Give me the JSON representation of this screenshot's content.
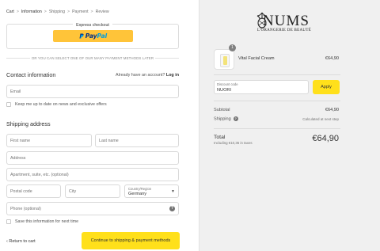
{
  "breadcrumb": {
    "items": [
      "Cart",
      "Information",
      "Shipping",
      "Payment",
      "Review"
    ],
    "separator": ">"
  },
  "express": {
    "title": "Express checkout",
    "paypal_part1": "Pay",
    "paypal_part2": "Pal",
    "paypal_color": "#ffc439"
  },
  "divider": "OR YOU CAN SELECT ONE OF OUR MANY PAYMENT METHODS LATER",
  "contact": {
    "title": "Contact information",
    "account_prompt": "Already have an account?",
    "login_link": "Log in",
    "email_placeholder": "Email",
    "newsletter_label": "Keep me up to date on news and exclusive offers"
  },
  "shipping": {
    "title": "Shipping address",
    "first_name_placeholder": "First name",
    "last_name_placeholder": "Last name",
    "address_placeholder": "Address",
    "apartment_placeholder": "Apartment, suite, etc. (optional)",
    "postal_placeholder": "Postal code",
    "city_placeholder": "City",
    "country_label": "Country/Region",
    "country_value": "Germany",
    "phone_placeholder": "Phone (optional)",
    "save_label": "Save this information for next time"
  },
  "footer": {
    "return_label": "Return to cart",
    "continue_label": "Continue to shipping & payment methods"
  },
  "brand": {
    "name": "NUMS",
    "tagline": "L'ORANGERIE DE BEAUTÉ"
  },
  "order": {
    "product_name": "Vital Facial Cream",
    "product_price": "€64,90",
    "quantity": "1",
    "discount_label": "Discount code",
    "discount_value": "NUORI",
    "apply_label": "Apply",
    "subtotal_label": "Subtotal",
    "subtotal_value": "€64,90",
    "shipping_label": "Shipping",
    "shipping_value": "Calculated at next step",
    "total_label": "Total",
    "total_taxes": "Including €10,36 in taxes",
    "total_value": "€64,90"
  },
  "colors": {
    "accent_button": "#ffe01b",
    "sidebar_bg": "#f0f0f0"
  }
}
